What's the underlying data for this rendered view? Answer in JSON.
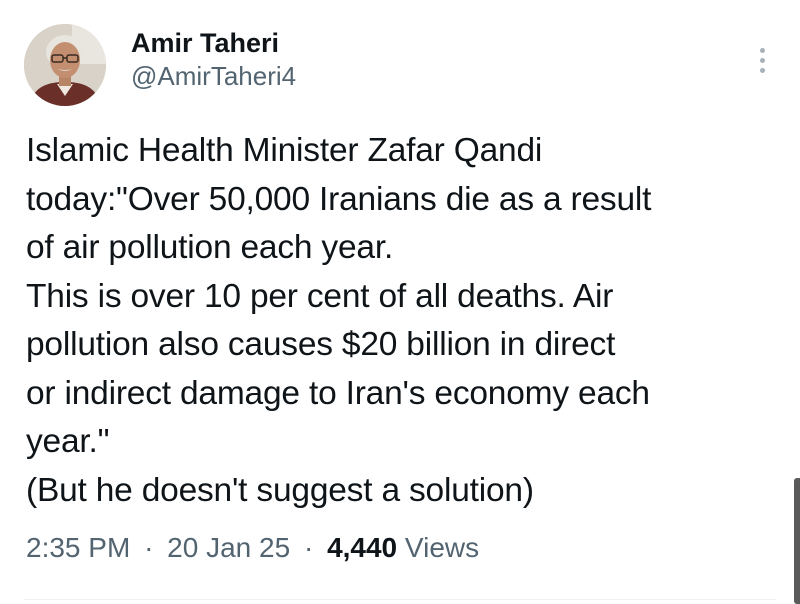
{
  "author": {
    "display_name": "Amir Taheri",
    "handle": "@AmirTaheri4"
  },
  "tweet": {
    "lines": [
      "Islamic Health Minister Zafar Qandi",
      "today:\"Over 50,000 Iranians die as a result",
      "of air pollution each year.",
      "This is over 10 per cent of all deaths. Air",
      "pollution also causes $20 billion in direct",
      "or indirect damage to Iran's economy each",
      "year.\"",
      "(But he doesn't suggest a solution)"
    ]
  },
  "meta": {
    "time": "2:35 PM",
    "date": "20 Jan 25",
    "separator": "·",
    "views_count": "4,440",
    "views_label": "Views"
  },
  "icons": {
    "more": "more-vertical-icon"
  },
  "colors": {
    "text_primary": "#0f1419",
    "text_secondary": "#536471",
    "more_dots": "#a7b1b9"
  }
}
